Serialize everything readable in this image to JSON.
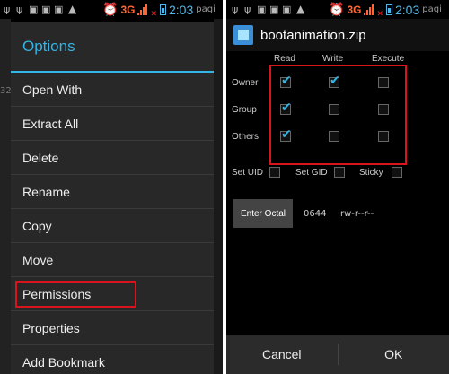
{
  "statusbar": {
    "network": "3G",
    "time": "2:03",
    "extra": "pagi"
  },
  "left": {
    "dialog_title": "Options",
    "background_fragment": "32",
    "menu": [
      {
        "label": "Open With"
      },
      {
        "label": "Extract All"
      },
      {
        "label": "Delete"
      },
      {
        "label": "Rename"
      },
      {
        "label": "Copy"
      },
      {
        "label": "Move"
      },
      {
        "label": "Permissions"
      },
      {
        "label": "Properties"
      },
      {
        "label": "Add Bookmark"
      }
    ]
  },
  "right": {
    "title": "bootanimation.zip",
    "columns": [
      "Read",
      "Write",
      "Execute"
    ],
    "rows": [
      {
        "label": "Owner",
        "read": true,
        "write": true,
        "execute": false
      },
      {
        "label": "Group",
        "read": true,
        "write": false,
        "execute": false
      },
      {
        "label": "Others",
        "read": true,
        "write": false,
        "execute": false
      }
    ],
    "flags": [
      {
        "label": "Set UID",
        "checked": false
      },
      {
        "label": "Set GID",
        "checked": false
      },
      {
        "label": "Sticky",
        "checked": false
      }
    ],
    "octal_button": "Enter Octal",
    "octal_value": "0644",
    "symbolic_value": "rw-r--r--",
    "cancel_label": "Cancel",
    "ok_label": "OK"
  },
  "colors": {
    "accent": "#33b5e5",
    "highlight": "#d9141c",
    "network": "#ff6633"
  }
}
